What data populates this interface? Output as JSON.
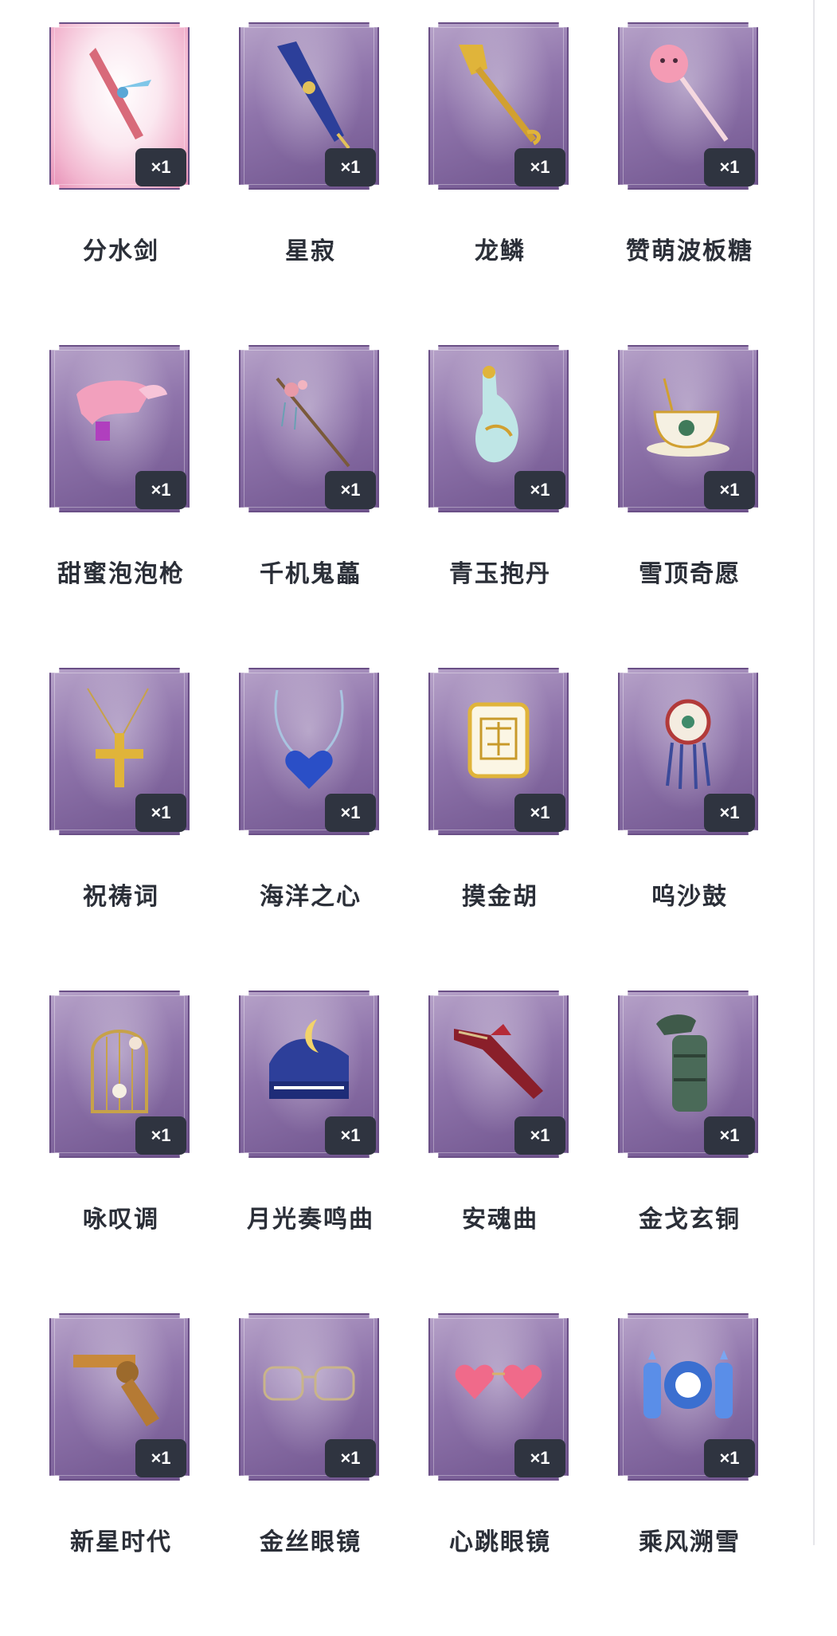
{
  "items": [
    {
      "name": "分水剑",
      "qty": "×1",
      "icon": "sword-icon"
    },
    {
      "name": "星寂",
      "qty": "×1",
      "icon": "scepter-icon"
    },
    {
      "name": "龙鳞",
      "qty": "×1",
      "icon": "shovel-icon"
    },
    {
      "name": "赞萌波板糖",
      "qty": "×1",
      "icon": "lollipop-icon"
    },
    {
      "name": "甜蜜泡泡枪",
      "qty": "×1",
      "icon": "bubble-gun-icon"
    },
    {
      "name": "千机鬼藟",
      "qty": "×1",
      "icon": "vine-staff-icon"
    },
    {
      "name": "青玉抱丹",
      "qty": "×1",
      "icon": "vase-icon"
    },
    {
      "name": "雪顶奇愿",
      "qty": "×1",
      "icon": "teacup-icon"
    },
    {
      "name": "祝祷词",
      "qty": "×1",
      "icon": "cross-pendant-icon"
    },
    {
      "name": "海洋之心",
      "qty": "×1",
      "icon": "heart-necklace-icon"
    },
    {
      "name": "摸金胡",
      "qty": "×1",
      "icon": "mahjong-tile-icon"
    },
    {
      "name": "呜沙鼓",
      "qty": "×1",
      "icon": "dreamcatcher-icon"
    },
    {
      "name": "咏叹调",
      "qty": "×1",
      "icon": "birdcage-icon"
    },
    {
      "name": "月光奏鸣曲",
      "qty": "×1",
      "icon": "piano-icon"
    },
    {
      "name": "安魂曲",
      "qty": "×1",
      "icon": "crimson-blade-icon"
    },
    {
      "name": "金戈玄铜",
      "qty": "×1",
      "icon": "bronze-grenade-icon"
    },
    {
      "name": "新星时代",
      "qty": "×1",
      "icon": "revolver-icon"
    },
    {
      "name": "金丝眼镜",
      "qty": "×1",
      "icon": "glasses-icon"
    },
    {
      "name": "心跳眼镜",
      "qty": "×1",
      "icon": "heart-glasses-icon"
    },
    {
      "name": "乘风溯雪",
      "qty": "×1",
      "icon": "snow-lantern-icon"
    }
  ],
  "colors": {
    "card_purple": "#8f74ab",
    "card_pink": "#f2b6cf",
    "badge_bg": "#2f3440",
    "label_text": "#2b2f38"
  }
}
